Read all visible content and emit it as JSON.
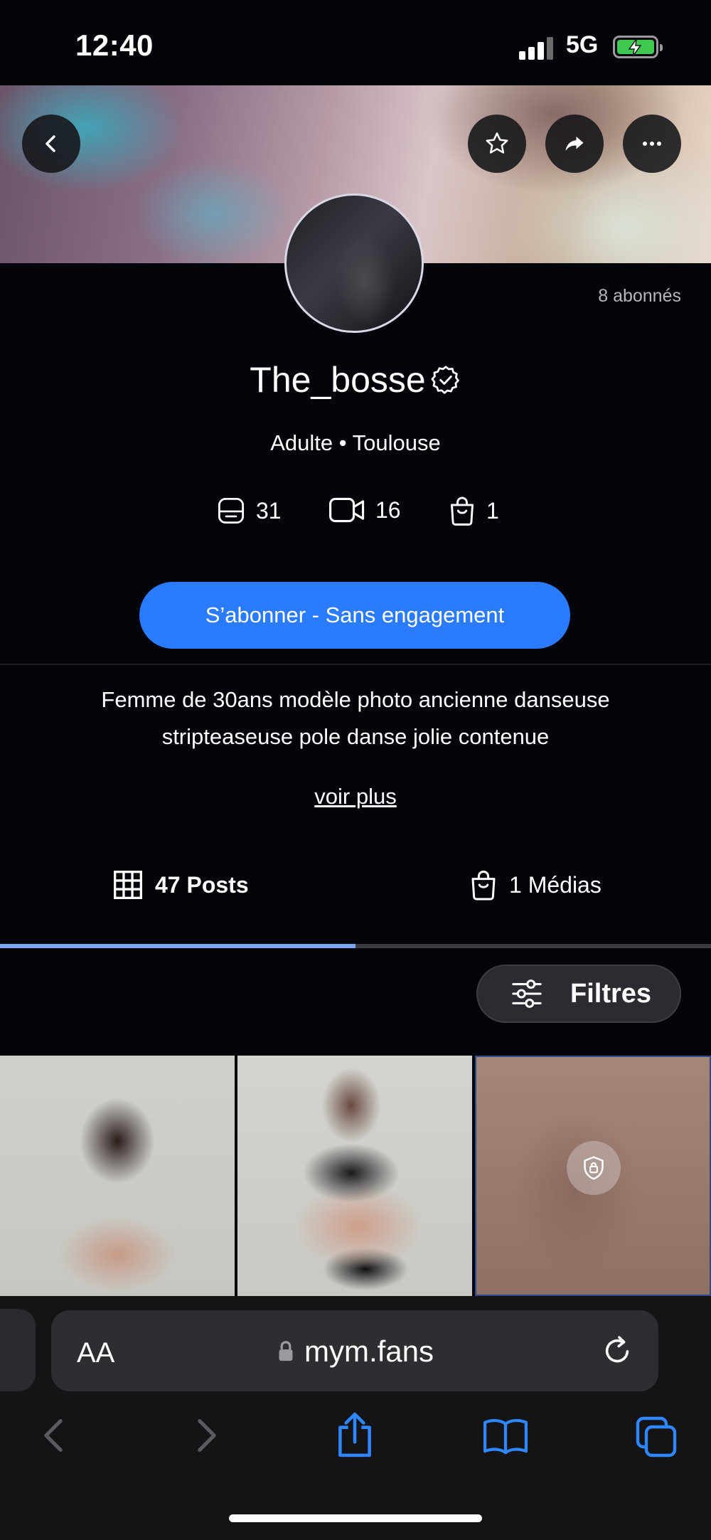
{
  "status_bar": {
    "time": "12:40",
    "network": "5G"
  },
  "header": {
    "back_icon": "chevron-left-icon",
    "favorite_icon": "star-icon",
    "share_icon": "share-arrow-icon",
    "more_icon": "ellipsis-icon"
  },
  "profile": {
    "subscribers": "8 abonnés",
    "name": "The_bosse",
    "verified_icon": "verified-badge-icon",
    "meta": "Adulte • Toulouse",
    "counters": [
      {
        "icon": "photo-icon",
        "value": "31"
      },
      {
        "icon": "video-icon",
        "value": "16"
      },
      {
        "icon": "bag-icon",
        "value": "1"
      }
    ],
    "subscribe_label": "S’abonner - Sans engagement",
    "bio_line1": "Femme de 30ans modèle photo ancienne danseuse",
    "bio_line2": "stripteaseuse pole danse jolie contenue",
    "see_more": "voir plus"
  },
  "tabs": [
    {
      "label": "47 Posts",
      "icon": "grid-icon",
      "active": true
    },
    {
      "label": "1 Médias",
      "icon": "bag-icon",
      "active": false
    }
  ],
  "filters": {
    "label": "Filtres",
    "icon": "sliders-icon"
  },
  "browser": {
    "text_size": "AA",
    "url": "mym.fans",
    "lock_icon": "lock-icon",
    "reload_icon": "reload-icon",
    "toolbar": [
      "back-arrow-icon",
      "forward-arrow-icon",
      "share-icon",
      "bookmarks-icon",
      "tabs-icon"
    ]
  },
  "colors": {
    "accent": "#2a7bff",
    "background": "#04050a",
    "tab_indicator": "#7aa6ee"
  }
}
